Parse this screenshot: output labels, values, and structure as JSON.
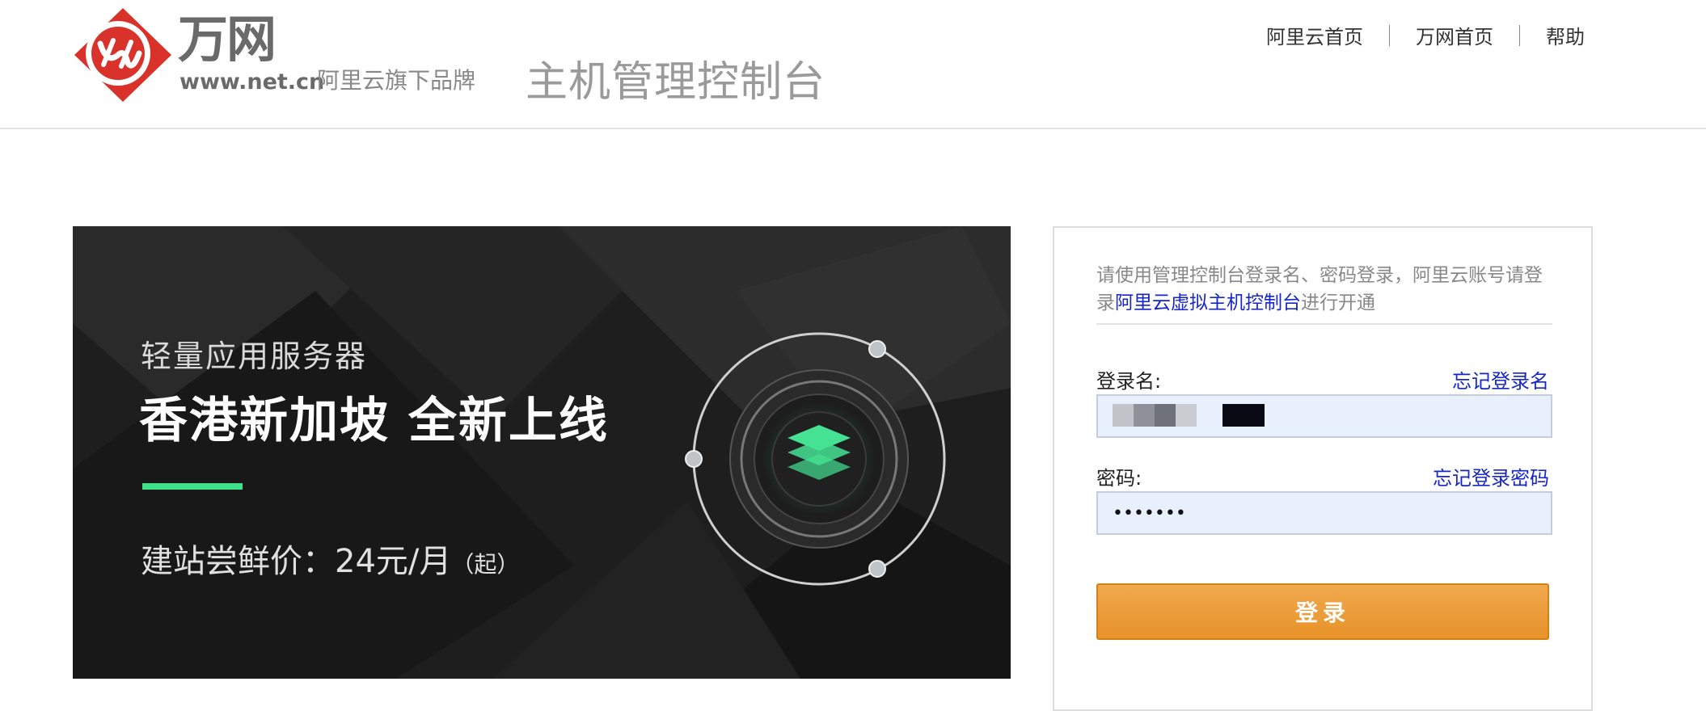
{
  "header": {
    "brand_name": "万网",
    "brand_url": "www.net.cn",
    "brand_tagline": "阿里云旗下品牌",
    "page_title": "主机管理控制台",
    "nav": [
      {
        "label": "阿里云首页"
      },
      {
        "label": "万网首页"
      },
      {
        "label": "帮助"
      }
    ]
  },
  "banner": {
    "line1": "轻量应用服务器",
    "line2": "香港新加坡 全新上线",
    "price": "建站尝鲜价：24元/月",
    "price_suffix": "（起）",
    "accent_color": "#3ee08a"
  },
  "login": {
    "notice_prefix": "请使用管理控制台登录名、密码登录，阿里云账号请登录",
    "notice_link": "阿里云虚拟主机控制台",
    "notice_suffix": "进行开通",
    "username_label": "登录名:",
    "forgot_username": "忘记登录名",
    "password_label": "密码:",
    "forgot_password": "忘记登录密码",
    "password_value": "•••••••",
    "submit_label": "登录",
    "link_color": "#1626c8",
    "button_color": "#e8922a"
  }
}
